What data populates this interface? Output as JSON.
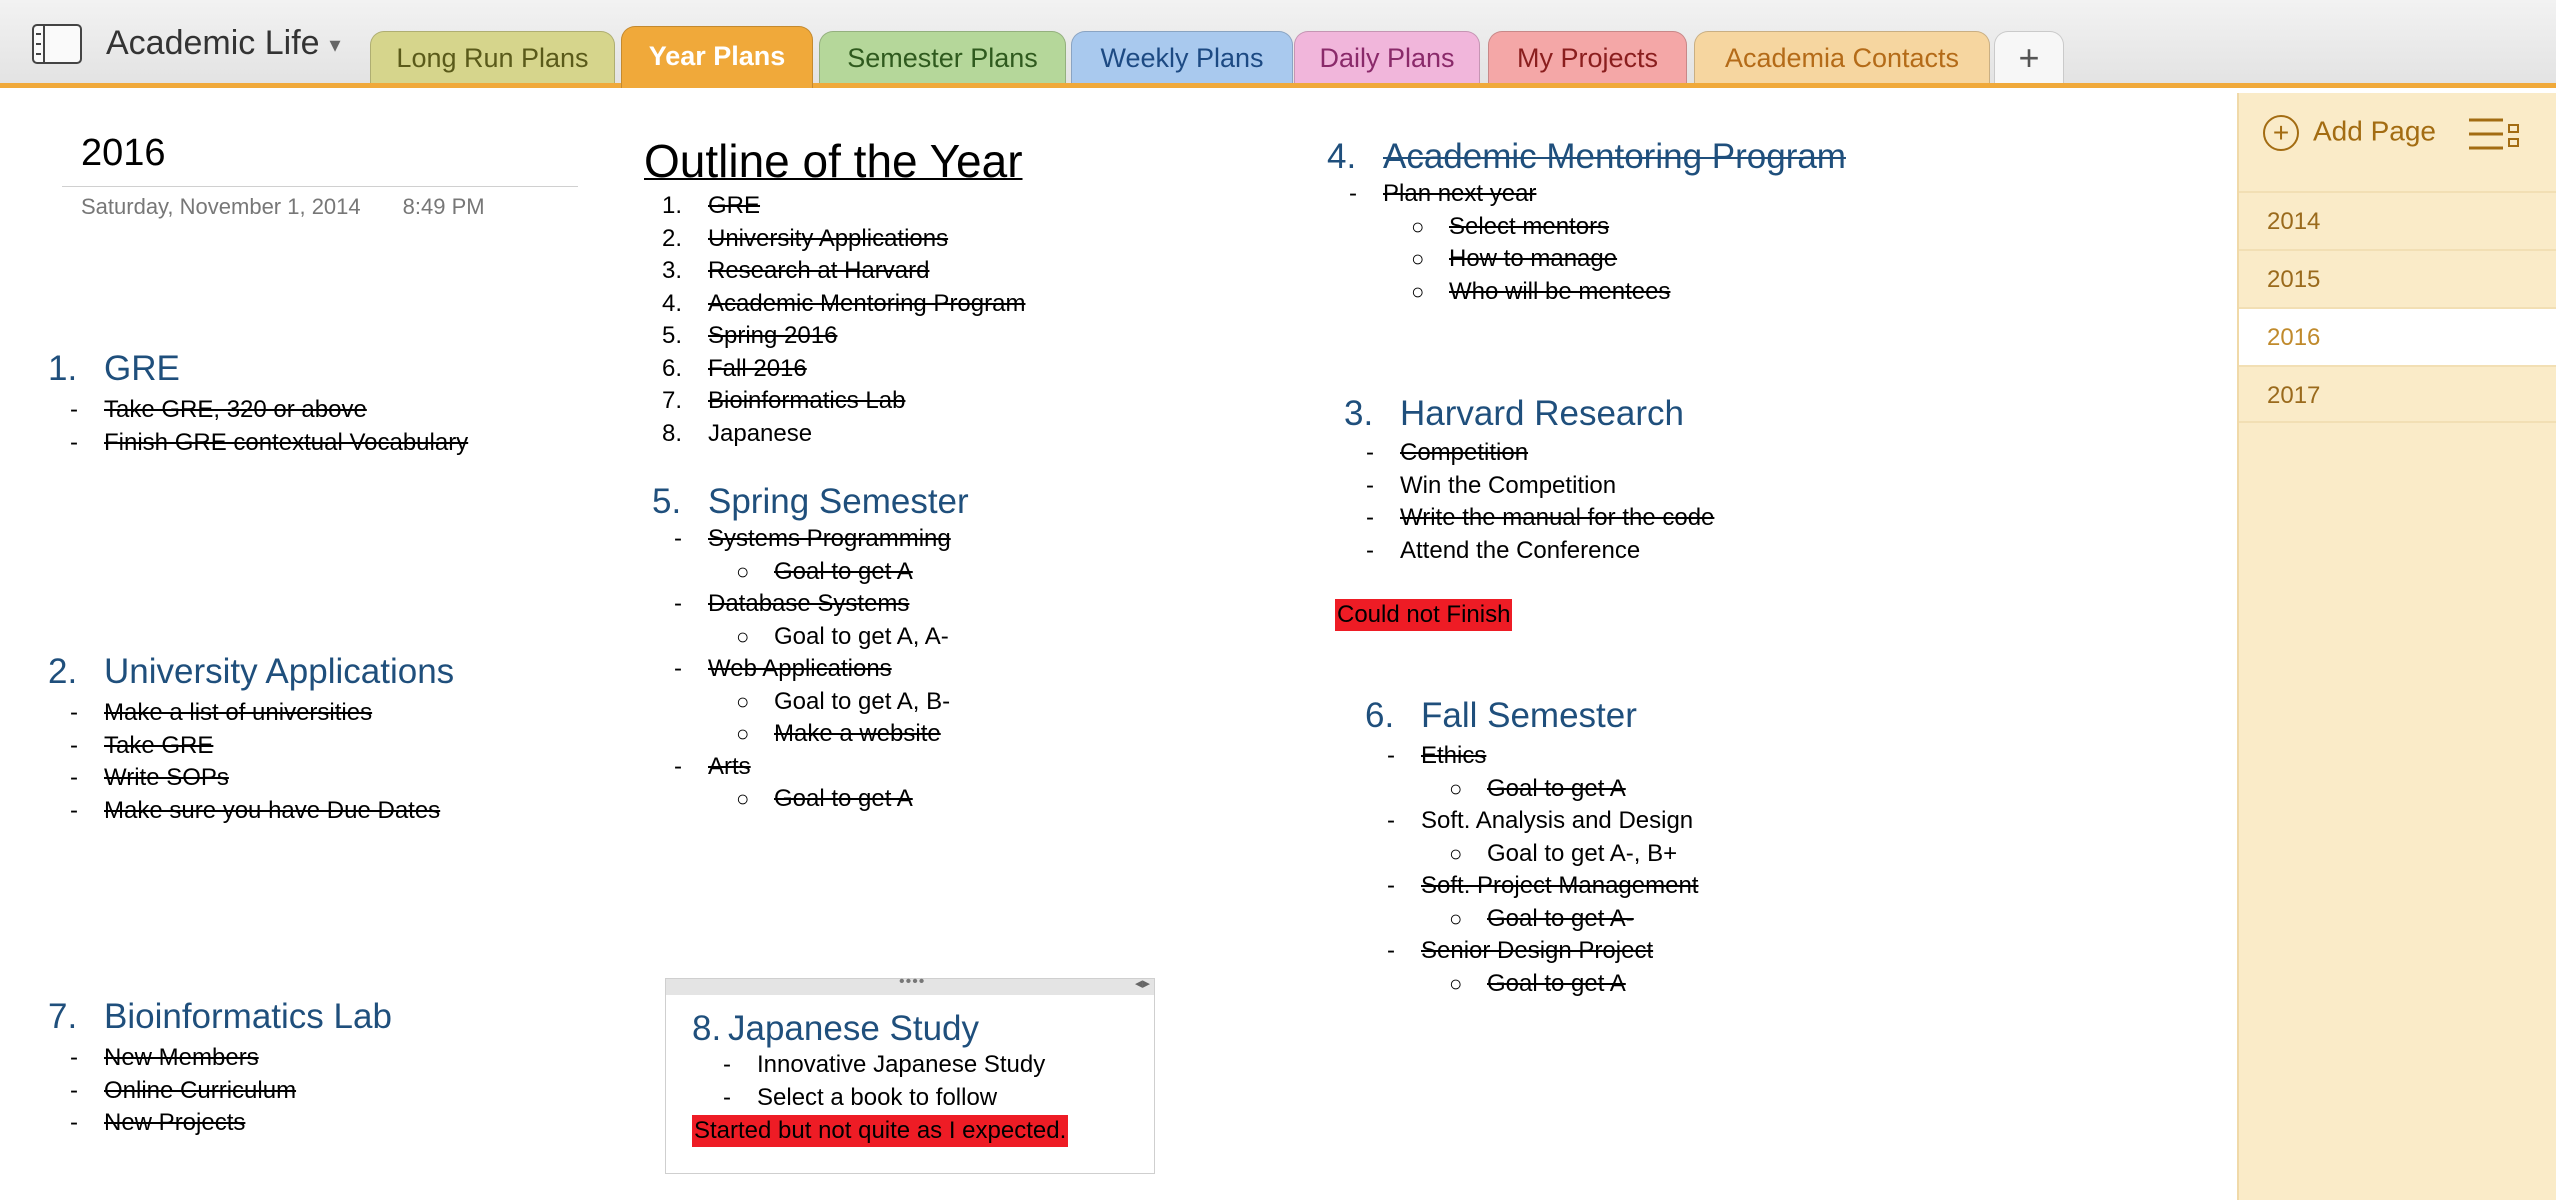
{
  "notebook": {
    "title": "Academic Life",
    "caret": "▾",
    "icon": "notebook-icon"
  },
  "tabs": [
    {
      "label": "Long Run Plans",
      "color": "#d6d58c",
      "text": "#5a5a1a"
    },
    {
      "label": "Year Plans",
      "color": "#f0a93a",
      "text": "#ffffff",
      "active": true
    },
    {
      "label": "Semester Plans",
      "color": "#b5d79a",
      "text": "#2f5a1e"
    },
    {
      "label": "Weekly Plans",
      "color": "#a9c9ee",
      "text": "#1d4a83"
    },
    {
      "label": "Daily Plans",
      "color": "#f1b6db",
      "text": "#8a2a6a"
    },
    {
      "label": "My Projects",
      "color": "#f4a7a7",
      "text": "#8a1e1e"
    },
    {
      "label": "Academia Contacts",
      "color": "#f6d6a0",
      "text": "#b46b18"
    }
  ],
  "add_tab": "+",
  "page": {
    "title": "2016",
    "date": "Saturday, November  1, 2014",
    "time": "8:49 PM"
  },
  "outline": {
    "title": "Outline of the Year",
    "items": [
      {
        "n": "1.",
        "text": "GRE",
        "done": true
      },
      {
        "n": "2.",
        "text": "University Applications",
        "done": true
      },
      {
        "n": "3.",
        "text": "Research at Harvard",
        "done": true
      },
      {
        "n": "4.",
        "text": "Academic Mentoring Program",
        "done": true
      },
      {
        "n": "5.",
        "text": "Spring 2016",
        "done": true
      },
      {
        "n": "6.",
        "text": "Fall 2016",
        "done": true
      },
      {
        "n": "7.",
        "text": "Bioinformatics Lab",
        "done": true
      },
      {
        "n": "8.",
        "text": "Japanese",
        "done": false
      }
    ]
  },
  "sections": {
    "gre": {
      "num": "1.",
      "title": "GRE",
      "items": [
        {
          "text": "Take GRE, 320 or above",
          "done": true
        },
        {
          "text": "Finish GRE contextual Vocabulary",
          "done": true
        }
      ]
    },
    "univ": {
      "num": "2.",
      "title": "University Applications",
      "items": [
        {
          "text": "Make a list of universities",
          "done": true
        },
        {
          "text": "Take GRE",
          "done": true
        },
        {
          "text": "Write SOPs",
          "done": true
        },
        {
          "text": "Make sure you have Due Dates",
          "done": true
        }
      ]
    },
    "bio": {
      "num": "7.",
      "title": "Bioinformatics Lab",
      "items": [
        {
          "text": "New Members",
          "done": true
        },
        {
          "text": "Online Curriculum",
          "done": true
        },
        {
          "text": "New Projects",
          "done": true
        }
      ]
    },
    "spring": {
      "num": "5.",
      "title": "Spring Semester",
      "items": [
        {
          "text": "Systems Programming",
          "done": true,
          "subs": [
            {
              "text": "Goal to get A",
              "done": true
            }
          ]
        },
        {
          "text": "Database Systems",
          "done": true,
          "subs": [
            {
              "text": "Goal to get A, A-",
              "done": false
            }
          ]
        },
        {
          "text": "Web Applications",
          "done": true,
          "subs": [
            {
              "text": "Goal to get A, B-",
              "done": false
            },
            {
              "text": "Make a website",
              "done": true
            }
          ]
        },
        {
          "text": "Arts",
          "done": true,
          "subs": [
            {
              "text": "Goal to get A",
              "done": true
            }
          ]
        }
      ]
    },
    "mentor": {
      "num": "4.",
      "title": "Academic Mentoring Program",
      "done": true,
      "items": [
        {
          "text": "Plan next year",
          "done": true,
          "subs": [
            {
              "text": "Select mentors",
              "done": true
            },
            {
              "text": "How to manage",
              "done": true
            },
            {
              "text": "Who will be mentees",
              "done": true
            }
          ]
        }
      ]
    },
    "harvard": {
      "num": "3.",
      "title": "Harvard Research",
      "items": [
        {
          "text": "Competition",
          "done": true
        },
        {
          "text": "Win the Competition",
          "done": false
        },
        {
          "text": "Write the manual for the code",
          "done": true
        },
        {
          "text": "Attend the Conference",
          "done": false
        }
      ],
      "note": "Could not Finish"
    },
    "fall": {
      "num": "6.",
      "title": "Fall Semester",
      "items": [
        {
          "text": "Ethics",
          "done": true,
          "subs": [
            {
              "text": "Goal to get A",
              "done": true
            }
          ]
        },
        {
          "text": "Soft. Analysis and Design",
          "done": false,
          "subs": [
            {
              "text": "Goal to get A-, B+",
              "done": false
            }
          ]
        },
        {
          "text": "Soft. Project Management",
          "done": true,
          "subs": [
            {
              "text": "Goal to get A-",
              "done": true
            }
          ]
        },
        {
          "text": "Senior Design Project",
          "done": true,
          "subs": [
            {
              "text": "Goal to get A",
              "done": true
            }
          ]
        }
      ]
    },
    "japanese": {
      "num": "8.",
      "title": "Japanese Study",
      "items": [
        {
          "text": "Innovative Japanese Study",
          "done": false
        },
        {
          "text": "Select a book to follow",
          "done": false
        }
      ],
      "note": "Started but not quite as I expected."
    }
  },
  "markers": {
    "dash": "-",
    "bullet": "○"
  },
  "note_container": {
    "grip": "••••",
    "resize": "◂▸"
  },
  "sidebar": {
    "add_page": "Add Page",
    "add_icon": "add-page-icon",
    "sort_icon": "page-sort-icon",
    "pages": [
      {
        "label": "2014",
        "selected": false
      },
      {
        "label": "2015",
        "selected": false
      },
      {
        "label": "2016",
        "selected": true
      },
      {
        "label": "2017",
        "selected": false
      }
    ]
  },
  "colors": {
    "accent": "#f0a93a",
    "heading": "#1f4f7c",
    "highlight": "#ee1c25",
    "sidebar": "#faebc8"
  }
}
